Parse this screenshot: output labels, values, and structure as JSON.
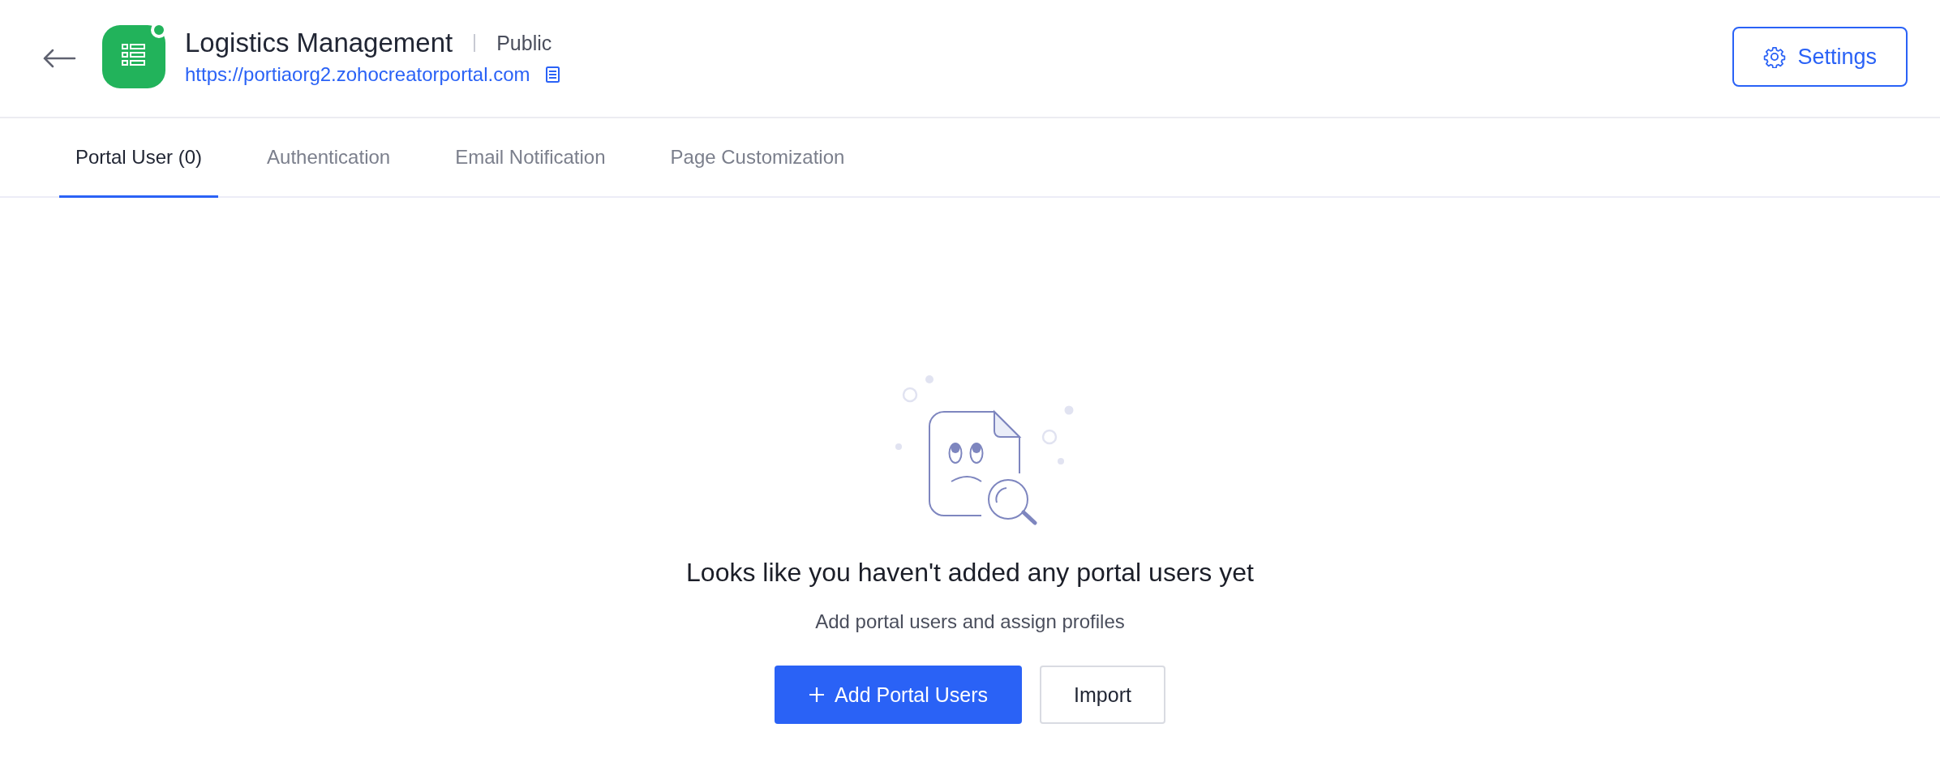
{
  "header": {
    "title": "Logistics Management",
    "visibility": "Public",
    "url": "https://portiaorg2.zohocreatorportal.com",
    "settings_button": "Settings"
  },
  "tabs": [
    {
      "label": "Portal User (0)",
      "selected": true
    },
    {
      "label": "Authentication",
      "selected": false
    },
    {
      "label": "Email Notification",
      "selected": false
    },
    {
      "label": "Page Customization",
      "selected": false
    }
  ],
  "empty_state": {
    "heading": "Looks like you haven't added any portal users yet",
    "subtitle": "Add portal users and assign profiles",
    "buttons": [
      {
        "label": "Add Portal Users",
        "kind": "primary"
      },
      {
        "label": "Import",
        "kind": "secondary"
      }
    ]
  }
}
